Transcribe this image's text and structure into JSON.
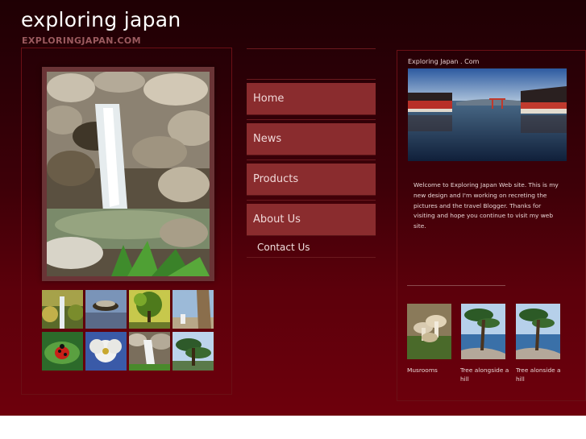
{
  "site": {
    "title": "exploring japan",
    "domain": "EXPLORINGJAPAN.COM"
  },
  "nav": {
    "items": [
      {
        "label": "Home"
      },
      {
        "label": "News"
      },
      {
        "label": "Products"
      },
      {
        "label": "About Us"
      }
    ],
    "contact_label": "Contact Us"
  },
  "right": {
    "heading": "Exploring Japan . Com",
    "welcome": "Welcome to Exploring Japan Web site. This is my new design and I'm working on recreting the pictures and the travel  Blogger. Thanks for visiting and hope you continue to visit my web site.",
    "thumbs": [
      {
        "caption": "Musrooms"
      },
      {
        "caption": "Tree alongside a hill"
      },
      {
        "caption": "Tree alonside a hill"
      }
    ]
  }
}
